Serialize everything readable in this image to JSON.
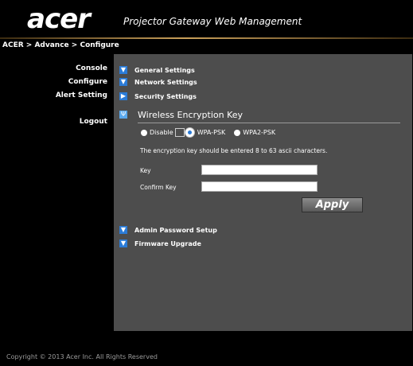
{
  "brand": {
    "logo": "acer",
    "title": "Projector Gateway Web Management"
  },
  "breadcrumb": "ACER > Advance > Configure",
  "sidebar": [
    "Console",
    "Configure",
    "Alert Setting",
    "Logout"
  ],
  "sections": {
    "general": "General Settings",
    "network": "Network Settings",
    "security": "Security Settings",
    "admin": "Admin Password Setup",
    "firmware": "Firmware Upgrade"
  },
  "wireless": {
    "title": "Wireless Encryption Key",
    "options": [
      "Disable",
      "WPA-PSK",
      "WPA2-PSK"
    ],
    "selected": "WPA-PSK",
    "note": "The encryption key should be entered 8 to 63 ascii characters.",
    "key_label": "Key",
    "key_value": "",
    "confirm_label": "Confirm Key",
    "confirm_value": "",
    "apply_label": "Apply"
  },
  "footer": "Copyright © 2013 Acer Inc. All Rights Reserved",
  "colors": {
    "panel": "#4d4d4d",
    "icon": "#2b7bd6"
  }
}
